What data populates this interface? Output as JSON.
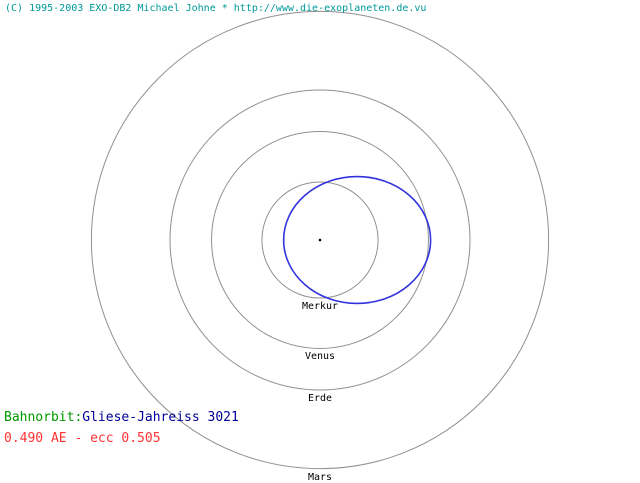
{
  "header": {
    "copyright": "(C) 1995-2003 EXO-DB2 Michael Johne * http://www.die-exoplaneten.de.vu"
  },
  "planet_orbits": [
    {
      "label": "Merkur",
      "radius_au": 0.387
    },
    {
      "label": "Venus",
      "radius_au": 0.723
    },
    {
      "label": "Erde",
      "radius_au": 1.0
    },
    {
      "label": "Mars",
      "radius_au": 1.524
    }
  ],
  "exoplanet_orbit": {
    "semi_major_axis_au": 0.49,
    "eccentricity": 0.505
  },
  "info": {
    "orbit_prefix": "Bahnorbit:",
    "system_name": "Gliese-Jahreiss 3021",
    "params": "0.490 AE - ecc 0.505"
  },
  "colors": {
    "copyright": "#009999",
    "orbit_prefix": "#009900",
    "system_name": "#000099",
    "params": "#ff3333",
    "planet_orbit": "#909090",
    "exo_orbit": "#3333dd",
    "star": "#000000",
    "label": "#000000"
  }
}
